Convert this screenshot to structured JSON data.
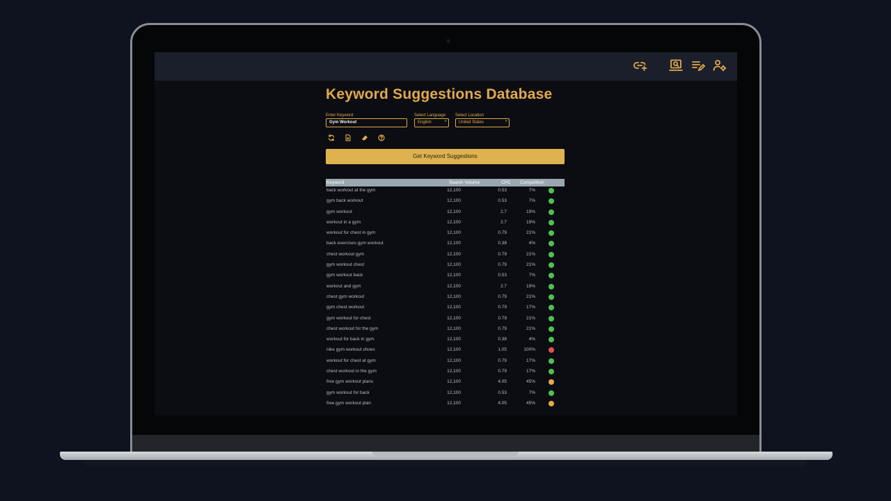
{
  "app": {
    "title": "Keyword Suggestions Database",
    "keyword_label": "Enter Keyword",
    "keyword_value": "Gym Workout",
    "language_label": "Select Language",
    "language_value": "English",
    "location_label": "Select Location",
    "location_value": "United States",
    "get_button": "Get Keyword Suggestions"
  },
  "icons": {
    "topbar": [
      "link-add-icon",
      "search-laptop-icon",
      "edit-list-icon",
      "user-settings-icon"
    ],
    "tools": [
      "refresh-icon",
      "export-file-icon",
      "eraser-icon",
      "help-icon"
    ]
  },
  "colors": {
    "accent": "#e3a94b",
    "button": "#ddb24f",
    "header_row": "#9aa7b1",
    "low": "#4fc14f",
    "medium": "#e3a94b",
    "high": "#e05252"
  },
  "table": {
    "headers": [
      "Keyword",
      "Search Volume",
      "CPC",
      "Competition"
    ],
    "rows": [
      {
        "keyword": "back workout at the gym",
        "volume": "12,100",
        "cpc": "0.53",
        "comp": "7%",
        "level": "low"
      },
      {
        "keyword": "gym back workout",
        "volume": "12,100",
        "cpc": "0.53",
        "comp": "7%",
        "level": "low"
      },
      {
        "keyword": "gym workout",
        "volume": "12,100",
        "cpc": "2.7",
        "comp": "19%",
        "level": "low"
      },
      {
        "keyword": "workout in a gym",
        "volume": "12,100",
        "cpc": "2.7",
        "comp": "19%",
        "level": "low"
      },
      {
        "keyword": "workout for chest in gym",
        "volume": "12,100",
        "cpc": "0.79",
        "comp": "21%",
        "level": "low"
      },
      {
        "keyword": "back exercises gym workout",
        "volume": "12,100",
        "cpc": "0.38",
        "comp": "4%",
        "level": "low"
      },
      {
        "keyword": "chest workout gym",
        "volume": "12,100",
        "cpc": "0.79",
        "comp": "21%",
        "level": "low"
      },
      {
        "keyword": "gym workout chest",
        "volume": "12,100",
        "cpc": "0.79",
        "comp": "21%",
        "level": "low"
      },
      {
        "keyword": "gym workout back",
        "volume": "12,100",
        "cpc": "0.53",
        "comp": "7%",
        "level": "low"
      },
      {
        "keyword": "workout and gym",
        "volume": "12,100",
        "cpc": "2.7",
        "comp": "19%",
        "level": "low"
      },
      {
        "keyword": "chest gym workout",
        "volume": "12,100",
        "cpc": "0.79",
        "comp": "21%",
        "level": "low"
      },
      {
        "keyword": "gym chest workout",
        "volume": "12,100",
        "cpc": "0.79",
        "comp": "17%",
        "level": "low"
      },
      {
        "keyword": "gym workout for chest",
        "volume": "12,100",
        "cpc": "0.79",
        "comp": "21%",
        "level": "low"
      },
      {
        "keyword": "chest workout for the gym",
        "volume": "12,100",
        "cpc": "0.79",
        "comp": "21%",
        "level": "low"
      },
      {
        "keyword": "workout for back in gym",
        "volume": "12,100",
        "cpc": "0.38",
        "comp": "4%",
        "level": "low"
      },
      {
        "keyword": "nike gym workout shoes",
        "volume": "12,100",
        "cpc": "1.05",
        "comp": "100%",
        "level": "high"
      },
      {
        "keyword": "workout for chest at gym",
        "volume": "12,100",
        "cpc": "0.79",
        "comp": "17%",
        "level": "low"
      },
      {
        "keyword": "chest workout in the gym",
        "volume": "12,100",
        "cpc": "0.79",
        "comp": "17%",
        "level": "low"
      },
      {
        "keyword": "free gym workout plans",
        "volume": "12,100",
        "cpc": "4.05",
        "comp": "45%",
        "level": "medium"
      },
      {
        "keyword": "gym workout for back",
        "volume": "12,100",
        "cpc": "0.53",
        "comp": "7%",
        "level": "low"
      },
      {
        "keyword": "free gym workout plan",
        "volume": "12,100",
        "cpc": "4.05",
        "comp": "45%",
        "level": "medium"
      }
    ]
  }
}
